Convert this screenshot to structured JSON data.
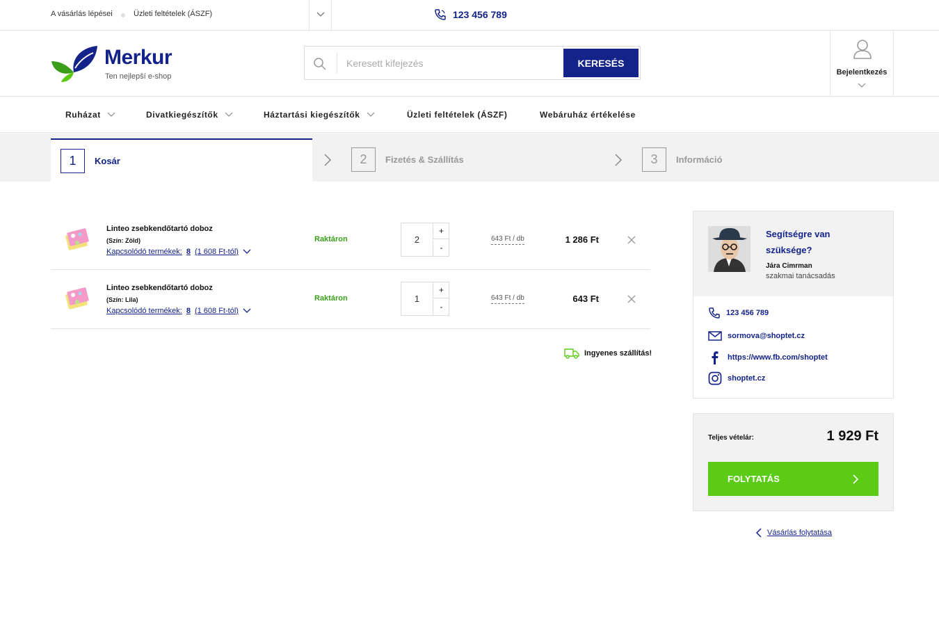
{
  "topbar": {
    "link_steps": "A vásárlás lépései",
    "link_terms": "Üzleti feltételek (ÁSZF)",
    "phone": "123 456 789"
  },
  "header": {
    "logo_name": "Merkur",
    "logo_tagline": "Ten nejlepší e-shop",
    "search_placeholder": "Keresett kifejezés",
    "search_button": "KERESÉS",
    "login_label": "Bejelentkezés"
  },
  "nav": {
    "items": [
      {
        "label": "Ruházat",
        "has_dropdown": true
      },
      {
        "label": "Divatkiegészítők",
        "has_dropdown": true
      },
      {
        "label": "Háztartási kiegészítők",
        "has_dropdown": true
      },
      {
        "label": "Üzleti feltételek (ÁSZF)",
        "has_dropdown": false
      },
      {
        "label": "Webáruház értékelése",
        "has_dropdown": false
      }
    ]
  },
  "steps": [
    {
      "number": "1",
      "label": "Kosár",
      "active": true
    },
    {
      "number": "2",
      "label": "Fizetés & Szállítás",
      "active": false
    },
    {
      "number": "3",
      "label": "Információ",
      "active": false
    }
  ],
  "cart": {
    "items": [
      {
        "name": "Linteo zsebkendőtartó doboz",
        "variant": "(Szín: Zöld)",
        "related_prefix": "Kapcsolódó termékek:",
        "related_count": "8",
        "related_price": "(1 608 Ft-tól)",
        "stock": "Raktáron",
        "quantity": "2",
        "unit_price": "643 Ft / db",
        "total": "1 286 Ft"
      },
      {
        "name": "Linteo zsebkendőtartó doboz",
        "variant": "(Szín: Lila)",
        "related_prefix": "Kapcsolódó termékek:",
        "related_count": "8",
        "related_price": "(1 608 Ft-tól)",
        "stock": "Raktáron",
        "quantity": "1",
        "unit_price": "643 Ft / db",
        "total": "643 Ft"
      }
    ],
    "qty_plus": "+",
    "qty_minus": "-",
    "free_shipping": "Ingyenes szállítás!"
  },
  "help": {
    "title": "Segítségre van szüksége?",
    "name": "Jára Cimrman",
    "role": "szakmai tanácsadás",
    "phone": "123 456 789",
    "email": "sormova@shoptet.cz",
    "facebook": "https://www.fb.com/shoptet",
    "instagram": "shoptet.cz"
  },
  "summary": {
    "total_label": "Teljes vételár:",
    "total_value": "1 929 Ft",
    "continue_button": "FOLYTATÁS",
    "back_link": "Vásárlás folytatása"
  },
  "colors": {
    "primary": "#13238a",
    "accent_green": "#5ccb16",
    "stock_green": "#3a9e1a",
    "panel_bg": "#f2f2f2"
  }
}
